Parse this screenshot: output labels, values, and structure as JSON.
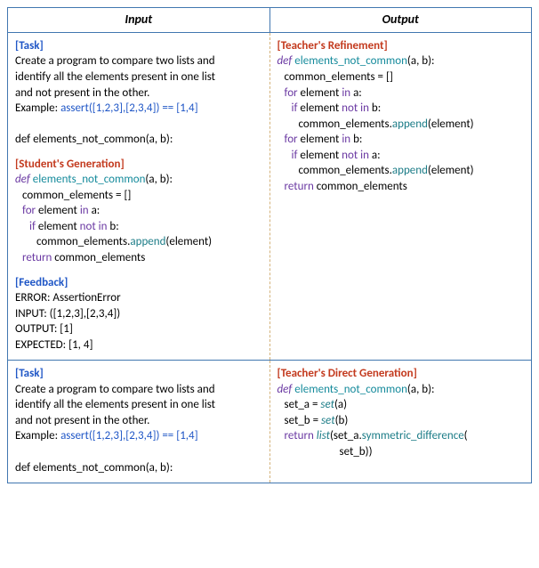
{
  "headers": {
    "input": "Input",
    "output": "Output"
  },
  "row1": {
    "input": {
      "task_label": "[Task]",
      "task_desc_l1": "Create a program to compare two lists and",
      "task_desc_l2": "identify all the elements present in one list",
      "task_desc_l3": "and not present in the other.",
      "example_prefix": "Example: ",
      "example_code": "assert([1,2,3],[2,3,4]) == [1,4]",
      "def_line_pre": "def elements_not_common(a, b):",
      "student_label": "[Student's Generation]",
      "s_def_kw": "def",
      "s_def_name": " elements_not_common",
      "s_def_args": "(a, b):",
      "s_l1_a": "common_elements = []",
      "s_l2_kw": "for",
      "s_l2_a": " element ",
      "s_l2_kw2": "in",
      "s_l2_b": " a:",
      "s_l3_kw": "if",
      "s_l3_a": " element ",
      "s_l3_kw2": "not in",
      "s_l3_b": " b:",
      "s_l4_a": "common_elements.",
      "s_l4_b": "append",
      "s_l4_c": "(element)",
      "s_l5_kw": "return",
      "s_l5_a": " common_elements",
      "feedback_label": "[Feedback]",
      "fb_l1": "ERROR: AssertionError",
      "fb_l2": "INPUT: ([1,2,3],[2,3,4])",
      "fb_l3": "OUTPUT: [1]",
      "fb_l4": "EXPECTED: [1, 4]"
    },
    "output": {
      "teacher_label": "[Teacher's Refinement]",
      "t_def_kw": "def",
      "t_def_name": " elements_not_common",
      "t_def_args": "(a, b):",
      "t_l1": "common_elements = []",
      "t_l2_kw": "for",
      "t_l2_a": " element ",
      "t_l2_kw2": "in",
      "t_l2_b": " a:",
      "t_l3_kw": "if",
      "t_l3_a": " element ",
      "t_l3_kw2": "not in",
      "t_l3_b": " b:",
      "t_l4_a": "common_elements.",
      "t_l4_b": "append",
      "t_l4_c": "(element)",
      "t_l5_kw": "for",
      "t_l5_a": " element ",
      "t_l5_kw2": "in",
      "t_l5_b": " b:",
      "t_l6_kw": "if",
      "t_l6_a": " element ",
      "t_l6_kw2": "not in",
      "t_l6_b": " a:",
      "t_l7_a": "common_elements.",
      "t_l7_b": "append",
      "t_l7_c": "(element)",
      "t_l8_kw": "return",
      "t_l8_a": " common_elements"
    }
  },
  "row2": {
    "input": {
      "task_label": "[Task]",
      "task_desc_l1": "Create a program to compare two lists and",
      "task_desc_l2": "identify all the elements present in one list",
      "task_desc_l3": "and not present in the other.",
      "example_prefix": "Example: ",
      "example_code": "assert([1,2,3],[2,3,4]) == [1,4]",
      "def_line_pre": "def elements_not_common(a, b):"
    },
    "output": {
      "teacher_label": "[Teacher's Direct Generation]",
      "d_def_kw": "def",
      "d_def_name": " elements_not_common",
      "d_def_args": "(a, b):",
      "d_l1_a": "set_a = ",
      "d_l1_b": "set",
      "d_l1_c": "(a)",
      "d_l2_a": "set_b = ",
      "d_l2_b": "set",
      "d_l2_c": "(b)",
      "d_l3_kw": "return ",
      "d_l3_b": "list",
      "d_l3_c": "(set_a.",
      "d_l3_d": "symmetric_difference",
      "d_l3_e": "(",
      "d_l4_a": "set_b))"
    }
  }
}
